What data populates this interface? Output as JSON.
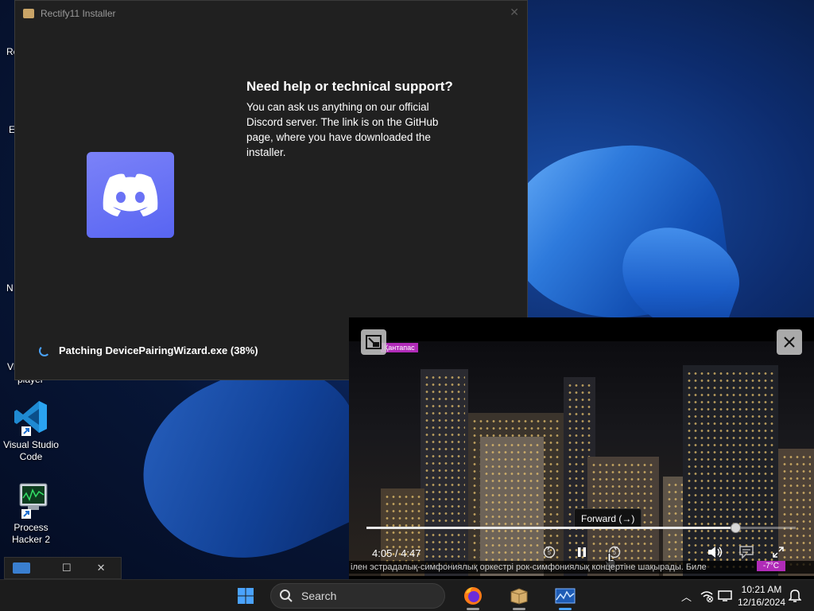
{
  "desktop": {
    "icons": [
      {
        "label": "Visual Studio Code"
      },
      {
        "label": "Process Hacker 2"
      }
    ],
    "partial_labels": [
      "Re",
      "E",
      "N",
      "Vl",
      "player"
    ]
  },
  "installer": {
    "title": "Rectify11 Installer",
    "help_title": "Need help or technical support?",
    "help_body": "You can ask us anything on our official Discord server. The link is on the GitHub page, where you have downloaded the installer.",
    "status": "Patching DevicePairingWizard.exe (38%)",
    "progress_percent": 38
  },
  "player": {
    "channel_tag": "Қантапас",
    "time": "4:05 / 4:47",
    "progress_fraction": 0.86,
    "tooltip": "Forward (→)",
    "ticker": "ілен эстрадалық-симфониялық оркестрі рок-симфониялық концертіне шақырады. Биле",
    "temperature": "-7°C"
  },
  "taskbar": {
    "search_placeholder": "Search",
    "time": "10:21 AM",
    "date": "12/16/2024"
  },
  "colors": {
    "discord": "#5865f2",
    "accent": "#4aa3ff",
    "tag": "#b02bb8"
  }
}
